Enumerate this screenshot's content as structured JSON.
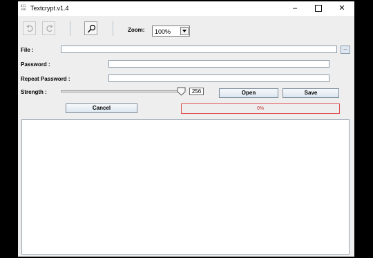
{
  "window": {
    "title": "Textcrypt.v1.4",
    "icon_text": "011 100",
    "controls": {
      "minimize": "–",
      "close": "✕"
    }
  },
  "toolbar": {
    "undo_icon": "undo-icon",
    "redo_icon": "redo-icon",
    "search_icon": "magnifier-icon",
    "zoom_label": "Zoom:",
    "zoom_value": "100%"
  },
  "form": {
    "file_label": "File :",
    "file_value": "",
    "browse_label": "...",
    "password_label": "Password :",
    "password_value": "",
    "repeat_password_label": "Repeat Password :",
    "repeat_password_value": "",
    "strength_label": "Strength :",
    "strength_value": "256",
    "strength_level": 1.0
  },
  "buttons": {
    "open": "Open",
    "save": "Save",
    "cancel": "Cancel"
  },
  "progress": {
    "text": "0%",
    "value": 0
  },
  "colors": {
    "progress_border": "#e05050",
    "progress_text": "#c03030"
  }
}
